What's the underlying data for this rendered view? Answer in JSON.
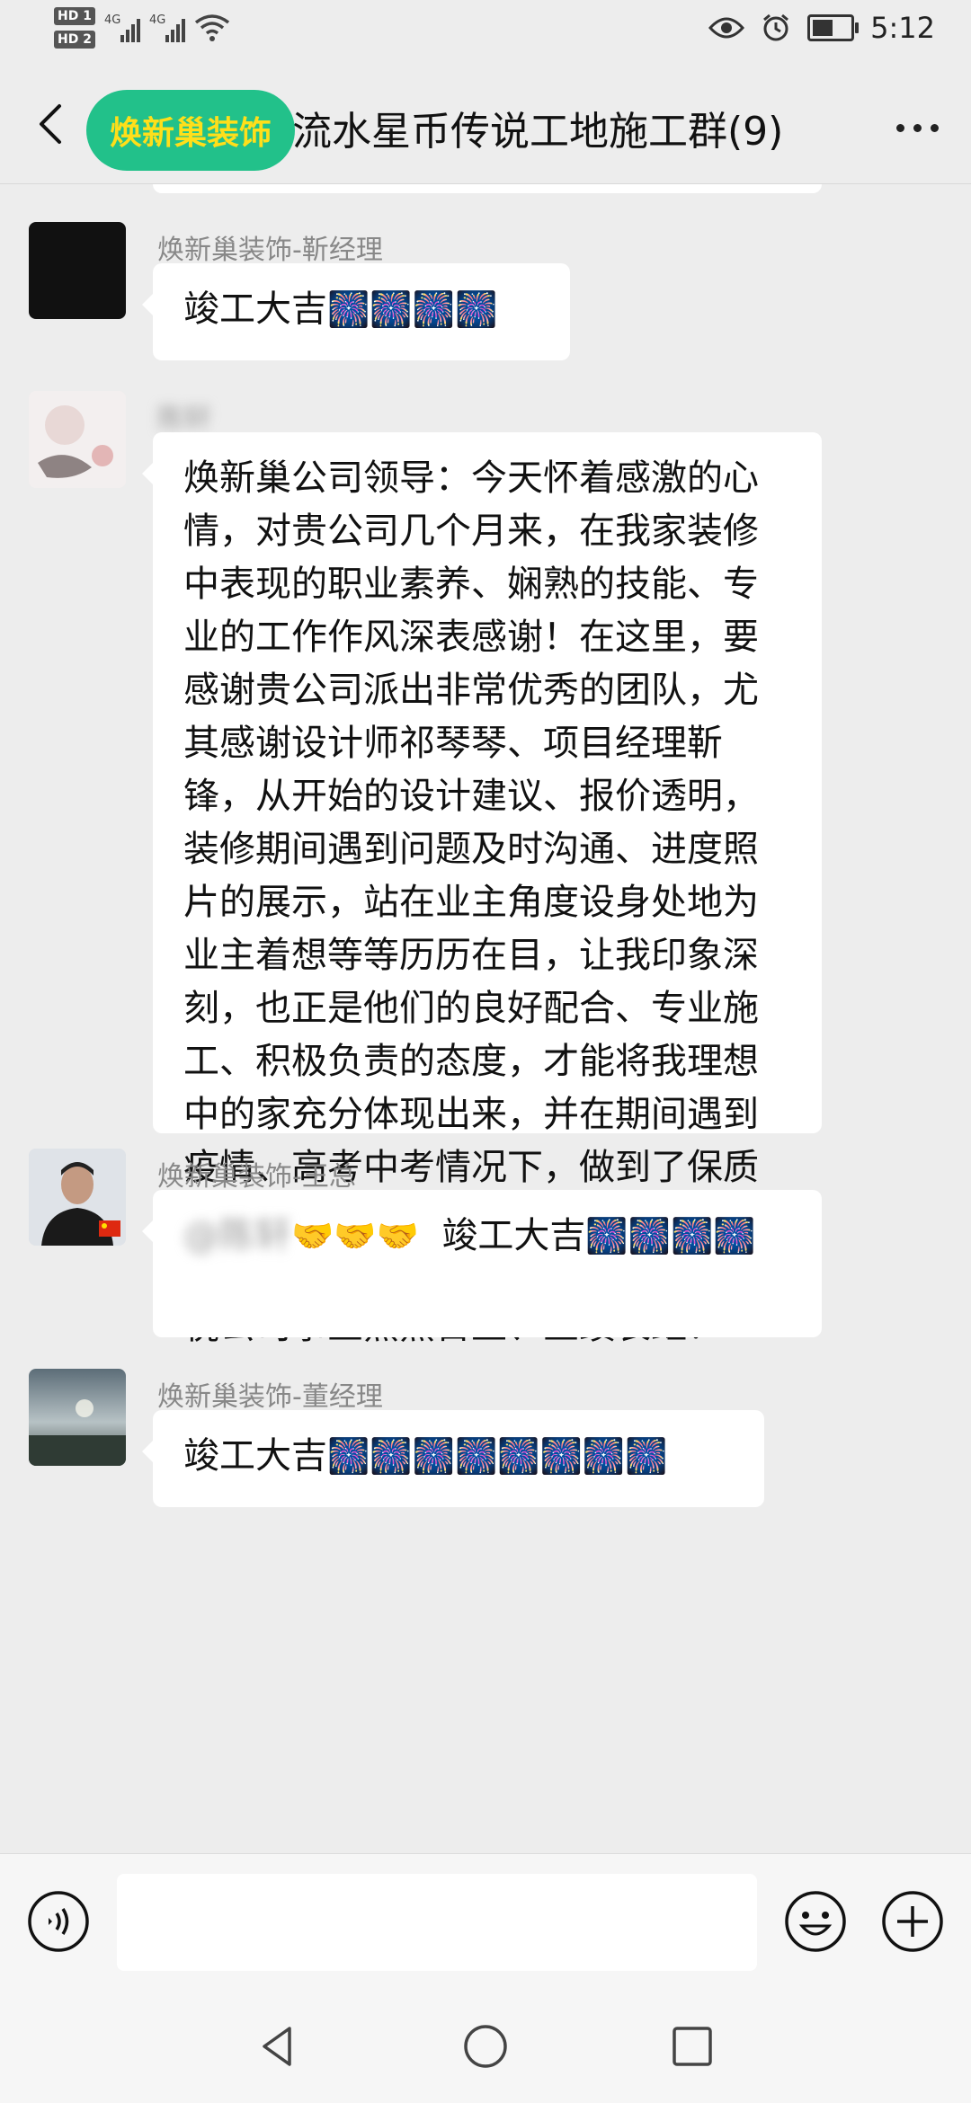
{
  "status_bar": {
    "hd1": "HD 1",
    "hd2": "HD 2",
    "net1": "4G",
    "net2": "4G",
    "time": "5:12",
    "battery_level": 0.55
  },
  "nav": {
    "title": "流水星币传说工地施工群(9)",
    "brand_badge": "焕新巢装饰"
  },
  "messages": [
    {
      "sender": "焕新巢装饰-靳经理",
      "text": "竣工大吉",
      "fireworks": "🎆🎆🎆🎆"
    },
    {
      "sender": "陈轩",
      "text": "焕新巢公司领导：今天怀着感激的心情，对贵公司几个月来，在我家装修中表现的职业素养、娴熟的技能、专业的工作作风深表感谢！在这里，要感谢贵公司派出非常优秀的团队，尤其感谢设计师祁琴琴、项目经理靳锋，从开始的设计建议、报价透明，装修期间遇到问题及时沟通、进度照片的展示，站在业主角度设身处地为业主着想等等历历在目，让我印象深刻，也正是他们的良好配合、专业施工、积极负责的态度，才能将我理想中的家充分体现出来，并在期间遇到疫情、高考中考情况下，做到了保质保量的承诺，我感到非常满意。再次请公司领导转达我对他们的谢意、并祝公司事业蒸蒸日上、业绩长虹！"
    },
    {
      "sender": "焕新巢装饰-王总",
      "mention": "@陈轩",
      "handshakes": "🤝🤝🤝",
      "text": "竣工大吉",
      "fireworks": "🎆🎆🎆🎆"
    },
    {
      "sender": "焕新巢装饰-董经理",
      "text": "竣工大吉",
      "fireworks": "🎆🎆🎆🎆🎆🎆🎆🎆"
    }
  ],
  "icons": {
    "voice": "voice-input-icon",
    "emoji": "emoji-icon",
    "plus": "plus-icon",
    "back": "back-arrow-icon",
    "more": "more-icon"
  }
}
